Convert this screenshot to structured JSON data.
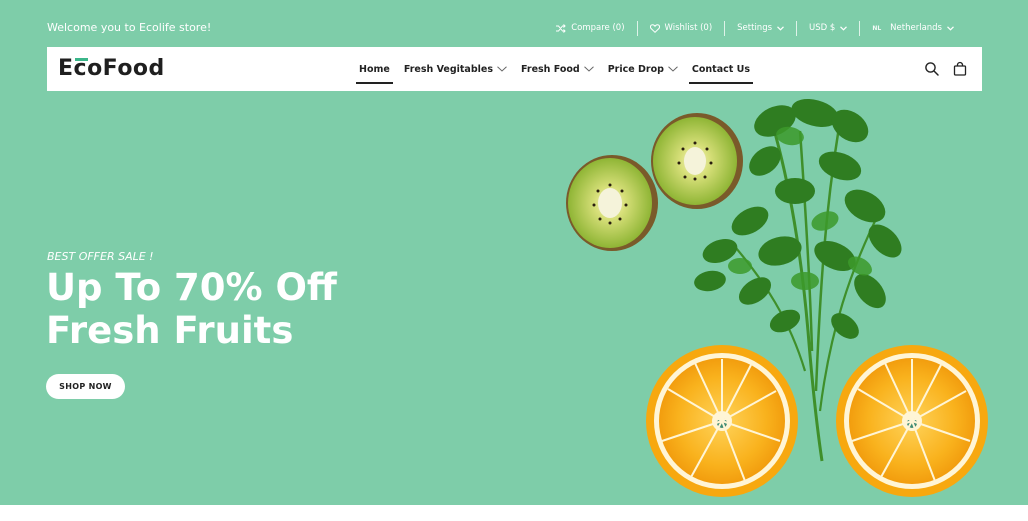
{
  "topbar": {
    "welcome": "Welcome you to Ecolife store!",
    "compare": "Compare (0)",
    "wishlist": "Wishlist (0)",
    "settings": "Settings",
    "currency": "USD $",
    "language_code": "NL",
    "language": "Netherlands"
  },
  "header": {
    "logo": "EcoFood",
    "menu": [
      {
        "label": "Home",
        "active": true
      },
      {
        "label": "Fresh Vegitables",
        "dropdown": true
      },
      {
        "label": "Fresh Food",
        "dropdown": true
      },
      {
        "label": "Price Drop",
        "dropdown": true
      },
      {
        "label": "Contact Us"
      }
    ],
    "icons": [
      "search-icon",
      "shopping-bag-icon"
    ]
  },
  "hero": {
    "tagline": "BEST OFFER SALE !",
    "headline_line1": "Up To 70% Off",
    "headline_line2": "Fresh Fruits",
    "cta": "SHOP NOW",
    "image_content": [
      "kiwi-slices",
      "parsley",
      "orange-halves"
    ]
  },
  "colors": {
    "hero_bg": "#7ecda9",
    "accent": "#3bb68a",
    "nav_bg": "#ffffff",
    "text_dark": "#222222"
  }
}
